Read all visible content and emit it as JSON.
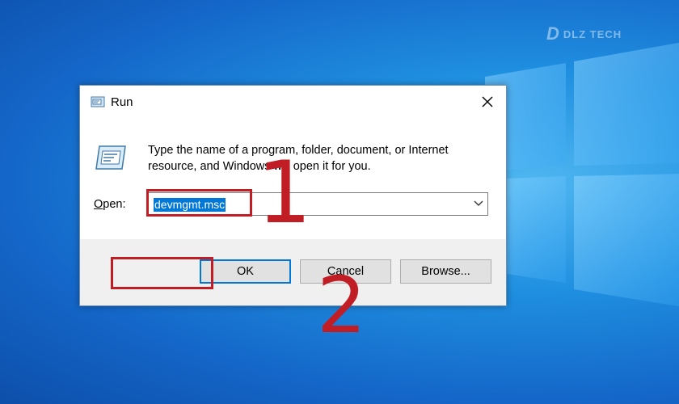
{
  "watermark": {
    "letter": "D",
    "text": "DLZ TECH"
  },
  "dialog": {
    "title": "Run",
    "description": "Type the name of a program, folder, document, or Internet resource, and Windows will open it for you.",
    "open_label_mnemonic": "O",
    "open_label_rest": "pen:",
    "open_value": "devmgmt.msc",
    "buttons": {
      "ok": "OK",
      "cancel": "Cancel",
      "browse": "Browse..."
    }
  },
  "annotations": {
    "step1": "1",
    "step2": "2",
    "color": "#c11d24"
  },
  "colors": {
    "selection": "#0078d7",
    "desktop": "#1f8fe0"
  },
  "icons": [
    "run-icon",
    "close-icon",
    "chevron-down-icon",
    "windows-logo"
  ]
}
